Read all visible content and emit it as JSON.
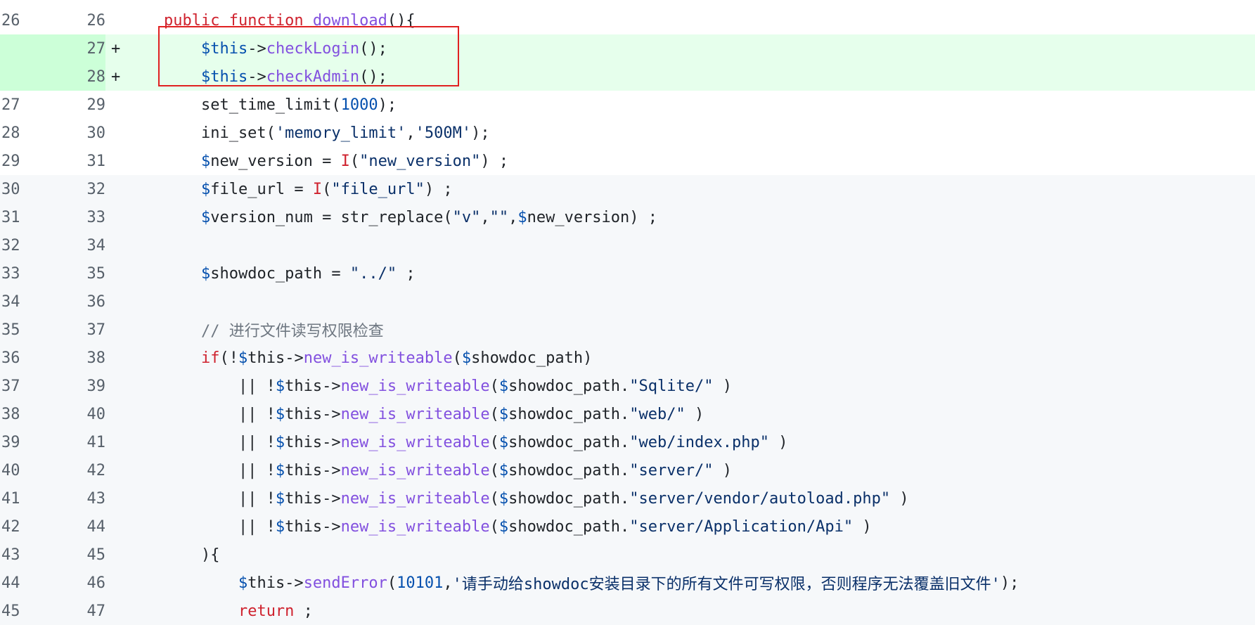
{
  "lines": [
    {
      "old": "26",
      "new": "26",
      "marker": "",
      "type": "context",
      "tokens": [
        [
          "plain",
          "    "
        ],
        [
          "kw",
          "public function "
        ],
        [
          "fn",
          "download"
        ],
        [
          "plain",
          "(){"
        ]
      ]
    },
    {
      "old": "",
      "new": "27",
      "marker": "+",
      "type": "add",
      "tokens": [
        [
          "plain",
          "        "
        ],
        [
          "var",
          "$this"
        ],
        [
          "plain",
          "->"
        ],
        [
          "fn",
          "checkLogin"
        ],
        [
          "plain",
          "();"
        ]
      ]
    },
    {
      "old": "",
      "new": "28",
      "marker": "+",
      "type": "add",
      "tokens": [
        [
          "plain",
          "        "
        ],
        [
          "var",
          "$this"
        ],
        [
          "plain",
          "->"
        ],
        [
          "fn",
          "checkAdmin"
        ],
        [
          "plain",
          "();"
        ]
      ]
    },
    {
      "old": "27",
      "new": "29",
      "marker": "",
      "type": "context",
      "tokens": [
        [
          "plain",
          "        set_time_limit("
        ],
        [
          "num",
          "1000"
        ],
        [
          "plain",
          ");"
        ]
      ]
    },
    {
      "old": "28",
      "new": "30",
      "marker": "",
      "type": "context",
      "tokens": [
        [
          "plain",
          "        ini_set("
        ],
        [
          "str",
          "'memory_limit'"
        ],
        [
          "plain",
          ","
        ],
        [
          "str",
          "'500M'"
        ],
        [
          "plain",
          ");"
        ]
      ]
    },
    {
      "old": "29",
      "new": "31",
      "marker": "",
      "type": "context",
      "tokens": [
        [
          "plain",
          "        "
        ],
        [
          "var",
          "$"
        ],
        [
          "plain",
          "new_version = "
        ],
        [
          "kw",
          "I"
        ],
        [
          "plain",
          "("
        ],
        [
          "str",
          "\"new_version\""
        ],
        [
          "plain",
          ") ;"
        ]
      ]
    },
    {
      "old": "30",
      "new": "32",
      "marker": "",
      "type": "context2",
      "tokens": [
        [
          "plain",
          "        "
        ],
        [
          "var",
          "$"
        ],
        [
          "plain",
          "file_url = "
        ],
        [
          "kw",
          "I"
        ],
        [
          "plain",
          "("
        ],
        [
          "str",
          "\"file_url\""
        ],
        [
          "plain",
          ") ;"
        ]
      ]
    },
    {
      "old": "31",
      "new": "33",
      "marker": "",
      "type": "context2",
      "tokens": [
        [
          "plain",
          "        "
        ],
        [
          "var",
          "$"
        ],
        [
          "plain",
          "version_num = str_replace("
        ],
        [
          "str",
          "\"v\""
        ],
        [
          "plain",
          ","
        ],
        [
          "str",
          "\"\""
        ],
        [
          "plain",
          ","
        ],
        [
          "var",
          "$"
        ],
        [
          "plain",
          "new_version) ;"
        ]
      ]
    },
    {
      "old": "32",
      "new": "34",
      "marker": "",
      "type": "context2",
      "tokens": []
    },
    {
      "old": "33",
      "new": "35",
      "marker": "",
      "type": "context2",
      "tokens": [
        [
          "plain",
          "        "
        ],
        [
          "var",
          "$"
        ],
        [
          "plain",
          "showdoc_path = "
        ],
        [
          "str",
          "\"../\""
        ],
        [
          "plain",
          " ;"
        ]
      ]
    },
    {
      "old": "34",
      "new": "36",
      "marker": "",
      "type": "context2",
      "tokens": []
    },
    {
      "old": "35",
      "new": "37",
      "marker": "",
      "type": "context2",
      "tokens": [
        [
          "plain",
          "        "
        ],
        [
          "cm",
          "// 进行文件读写权限检查"
        ]
      ]
    },
    {
      "old": "36",
      "new": "38",
      "marker": "",
      "type": "context2",
      "tokens": [
        [
          "plain",
          "        "
        ],
        [
          "kw",
          "if"
        ],
        [
          "plain",
          "(!"
        ],
        [
          "var",
          "$"
        ],
        [
          "plain",
          "this->"
        ],
        [
          "fn",
          "new_is_writeable"
        ],
        [
          "plain",
          "("
        ],
        [
          "var",
          "$"
        ],
        [
          "plain",
          "showdoc_path)"
        ]
      ]
    },
    {
      "old": "37",
      "new": "39",
      "marker": "",
      "type": "context2",
      "tokens": [
        [
          "plain",
          "            || !"
        ],
        [
          "var",
          "$"
        ],
        [
          "plain",
          "this->"
        ],
        [
          "fn",
          "new_is_writeable"
        ],
        [
          "plain",
          "("
        ],
        [
          "var",
          "$"
        ],
        [
          "plain",
          "showdoc_path."
        ],
        [
          "str",
          "\"Sqlite/\""
        ],
        [
          "plain",
          " )"
        ]
      ]
    },
    {
      "old": "38",
      "new": "40",
      "marker": "",
      "type": "context2",
      "tokens": [
        [
          "plain",
          "            || !"
        ],
        [
          "var",
          "$"
        ],
        [
          "plain",
          "this->"
        ],
        [
          "fn",
          "new_is_writeable"
        ],
        [
          "plain",
          "("
        ],
        [
          "var",
          "$"
        ],
        [
          "plain",
          "showdoc_path."
        ],
        [
          "str",
          "\"web/\""
        ],
        [
          "plain",
          " )"
        ]
      ]
    },
    {
      "old": "39",
      "new": "41",
      "marker": "",
      "type": "context2",
      "tokens": [
        [
          "plain",
          "            || !"
        ],
        [
          "var",
          "$"
        ],
        [
          "plain",
          "this->"
        ],
        [
          "fn",
          "new_is_writeable"
        ],
        [
          "plain",
          "("
        ],
        [
          "var",
          "$"
        ],
        [
          "plain",
          "showdoc_path."
        ],
        [
          "str",
          "\"web/index.php\""
        ],
        [
          "plain",
          " )"
        ]
      ]
    },
    {
      "old": "40",
      "new": "42",
      "marker": "",
      "type": "context2",
      "tokens": [
        [
          "plain",
          "            || !"
        ],
        [
          "var",
          "$"
        ],
        [
          "plain",
          "this->"
        ],
        [
          "fn",
          "new_is_writeable"
        ],
        [
          "plain",
          "("
        ],
        [
          "var",
          "$"
        ],
        [
          "plain",
          "showdoc_path."
        ],
        [
          "str",
          "\"server/\""
        ],
        [
          "plain",
          " )"
        ]
      ]
    },
    {
      "old": "41",
      "new": "43",
      "marker": "",
      "type": "context2",
      "tokens": [
        [
          "plain",
          "            || !"
        ],
        [
          "var",
          "$"
        ],
        [
          "plain",
          "this->"
        ],
        [
          "fn",
          "new_is_writeable"
        ],
        [
          "plain",
          "("
        ],
        [
          "var",
          "$"
        ],
        [
          "plain",
          "showdoc_path."
        ],
        [
          "str",
          "\"server/vendor/autoload.php\""
        ],
        [
          "plain",
          " )"
        ]
      ]
    },
    {
      "old": "42",
      "new": "44",
      "marker": "",
      "type": "context2",
      "tokens": [
        [
          "plain",
          "            || !"
        ],
        [
          "var",
          "$"
        ],
        [
          "plain",
          "this->"
        ],
        [
          "fn",
          "new_is_writeable"
        ],
        [
          "plain",
          "("
        ],
        [
          "var",
          "$"
        ],
        [
          "plain",
          "showdoc_path."
        ],
        [
          "str",
          "\"server/Application/Api\""
        ],
        [
          "plain",
          " )"
        ]
      ]
    },
    {
      "old": "43",
      "new": "45",
      "marker": "",
      "type": "context2",
      "tokens": [
        [
          "plain",
          "        ){"
        ]
      ]
    },
    {
      "old": "44",
      "new": "46",
      "marker": "",
      "type": "context2",
      "tokens": [
        [
          "plain",
          "            "
        ],
        [
          "var",
          "$"
        ],
        [
          "plain",
          "this->"
        ],
        [
          "fn",
          "sendError"
        ],
        [
          "plain",
          "("
        ],
        [
          "num",
          "10101"
        ],
        [
          "plain",
          ","
        ],
        [
          "str",
          "'请手动给showdoc安装目录下的所有文件可写权限，否则程序无法覆盖旧文件'"
        ],
        [
          "plain",
          ");"
        ]
      ]
    },
    {
      "old": "45",
      "new": "47",
      "marker": "",
      "type": "context2",
      "tokens": [
        [
          "plain",
          "            "
        ],
        [
          "kw",
          "return"
        ],
        [
          "plain",
          " ;"
        ]
      ]
    }
  ]
}
